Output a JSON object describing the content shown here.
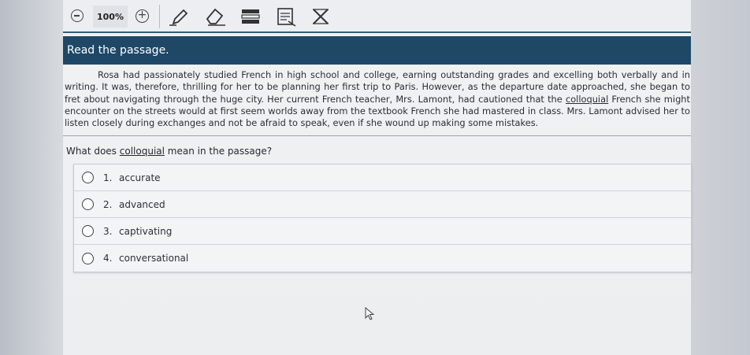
{
  "toolbar": {
    "zoom_level": "100%",
    "tools": [
      {
        "icon": "pencil-icon"
      },
      {
        "icon": "eraser-icon"
      },
      {
        "icon": "answer-masking-icon"
      },
      {
        "icon": "line-reader-icon"
      },
      {
        "icon": "eliminate-choice-icon"
      }
    ]
  },
  "header": {
    "instruction": "Read the passage."
  },
  "passage": {
    "part1": "Rosa had passionately studied French in high school and college, earning outstanding grades and excelling both verbally and in writing. It was, therefore, thrilling for her to be planning her first trip to Paris. However, as the departure date approached, she began to fret about navigating through the huge city. Her current French teacher, Mrs. Lamont, had cautioned that the ",
    "underlined": "colloquial",
    "part2": " French she might encounter on the streets would at first seem worlds away from the textbook French she had mastered in class. Mrs. Lamont advised her to listen closely during exchanges and not be afraid to speak, even if she wound up making some mistakes."
  },
  "question": {
    "prefix": "What does ",
    "word": "colloquial",
    "suffix": " mean in the passage?"
  },
  "options": [
    {
      "number": "1.",
      "text": "accurate"
    },
    {
      "number": "2.",
      "text": "advanced"
    },
    {
      "number": "3.",
      "text": "captivating"
    },
    {
      "number": "4.",
      "text": "conversational"
    }
  ],
  "colors": {
    "header_bg": "#1e4866",
    "toolbar_rule": "#2e5d7e"
  }
}
